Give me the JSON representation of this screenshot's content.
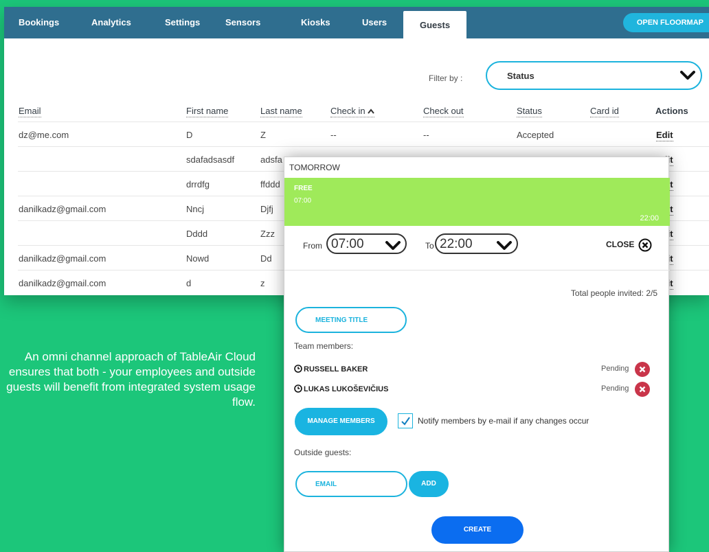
{
  "tabs": [
    {
      "label": "Bookings"
    },
    {
      "label": "Analytics"
    },
    {
      "label": "Settings"
    },
    {
      "label": "Sensors"
    },
    {
      "label": "Kiosks"
    },
    {
      "label": "Users"
    },
    {
      "label": "Guests",
      "active": true
    }
  ],
  "open_floormap_label": "OPEN FLOORMAP",
  "filter": {
    "label": "Filter by :",
    "value": "Status"
  },
  "table": {
    "headers": {
      "email": "Email",
      "first_name": "First name",
      "last_name": "Last name",
      "check_in": "Check in",
      "check_out": "Check out",
      "status": "Status",
      "card_id": "Card id",
      "actions": "Actions"
    },
    "rows": [
      {
        "email": "dz@me.com",
        "first": "D",
        "last": "Z",
        "check_in": "--",
        "check_out": "--",
        "status": "Accepted",
        "action": "Edit"
      },
      {
        "email": "",
        "first": "sdafadsasdf",
        "last": "adsfa",
        "check_in": "",
        "check_out": "",
        "status": "",
        "action": "Edit"
      },
      {
        "email": "",
        "first": "drrdfg",
        "last": "ffddd",
        "check_in": "",
        "check_out": "",
        "status": "",
        "action": "Edit"
      },
      {
        "email": "danilkadz@gmail.com",
        "first": "Nncj",
        "last": "Djfj",
        "check_in": "",
        "check_out": "",
        "status": "",
        "action": "Edit"
      },
      {
        "email": "",
        "first": "Dddd",
        "last": "Zzz",
        "check_in": "",
        "check_out": "",
        "status": "",
        "action": "Edit"
      },
      {
        "email": "danilkadz@gmail.com",
        "first": "Nowd",
        "last": "Dd",
        "check_in": "",
        "check_out": "",
        "status": "",
        "action": "Edit"
      },
      {
        "email": "danilkadz@gmail.com",
        "first": "d",
        "last": "z",
        "check_in": "",
        "check_out": "",
        "status": "",
        "action": "Edit"
      }
    ]
  },
  "booking": {
    "day": "TOMORROW",
    "slot_status": "FREE",
    "slot_start": "07:00",
    "slot_end": "22:00",
    "from_label": "From",
    "from_value": "07:00",
    "to_label": "To",
    "to_value": "22:00",
    "close_label": "CLOSE",
    "total_invited": "Total people invited: 2/5",
    "meeting_title_label": "MEETING TITLE",
    "team_members_label": "Team members:",
    "members": [
      {
        "name": "RUSSELL BAKER",
        "status": "Pending"
      },
      {
        "name": "LUKAS LUKOŠEVIČIUS",
        "status": "Pending"
      }
    ],
    "manage_members_label": "MANAGE MEMBERS",
    "notify_label": "Notify members by e-mail if any changes occur",
    "notify_checked": true,
    "outside_guests_label": "Outside guests:",
    "email_placeholder": "EMAIL",
    "add_label": "ADD",
    "create_label": "CREATE"
  },
  "promo_text": "An omni channel approach of TableAir Cloud ensures that both - your employees and outside guests will benefit from integrated system usage flow.",
  "colors": {
    "background": "#1cc67a",
    "tabbar": "#2f6e8f",
    "accent": "#1bb3dd",
    "free_slot": "#9fea5a",
    "create": "#0b6df0",
    "remove": "#c9354a"
  }
}
